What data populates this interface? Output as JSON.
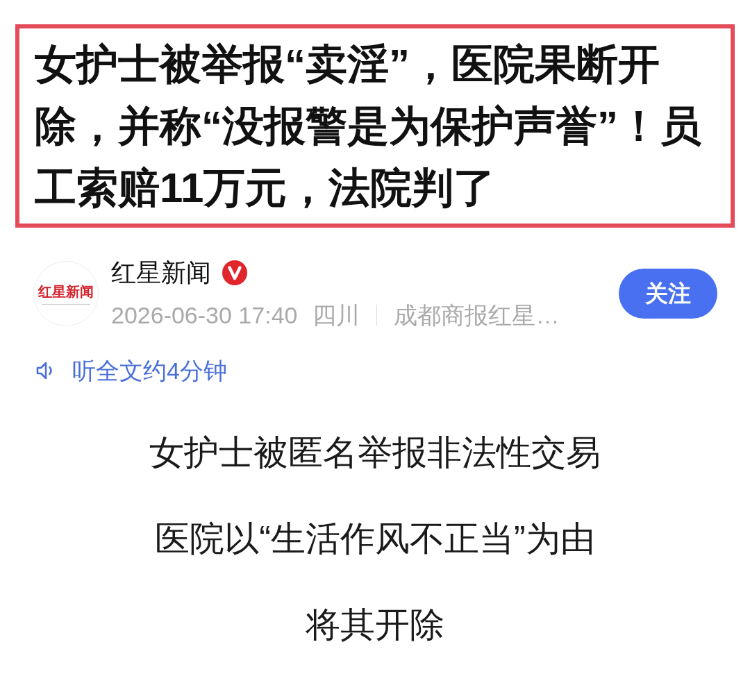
{
  "article": {
    "title": "女护士被举报“卖淫”，医院果断开除，并称“没报警是为保护声誉”！员工索赔11万元，法院判了"
  },
  "author": {
    "avatar_text": "红星新闻",
    "name": "红星新闻",
    "verified": true,
    "published": "2026-06-30 17:40",
    "location": "四川",
    "source": "成都商报红星…",
    "follow_button": "关注"
  },
  "listen": {
    "label": "听全文约4分钟"
  },
  "body": [
    "女护士被匿名举报非法性交易",
    "医院以“生活作风不正当”为由",
    "将其开除"
  ]
}
